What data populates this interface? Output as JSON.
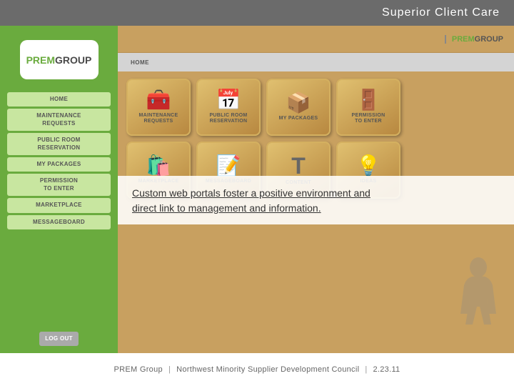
{
  "header": {
    "title": "Superior Client Care"
  },
  "sidebar": {
    "logo_prem": "PREM",
    "logo_group": "GROUP",
    "nav_items": [
      {
        "label": "HOME"
      },
      {
        "label": "MAINTENANCE REQUESTS"
      },
      {
        "label": "PUBLIC ROOM RESERVATION"
      },
      {
        "label": "MY PACKAGES"
      },
      {
        "label": "PERMISSION TO ENTER"
      },
      {
        "label": "MARKETPLACE"
      },
      {
        "label": "MESSAGEBOARD"
      }
    ]
  },
  "portal": {
    "logo_prem": "PREM",
    "logo_group": "GROUP",
    "nav_label": "HOME",
    "tiles": [
      {
        "icon": "🧰",
        "label": "MAINTENANCE\nREQUESTS"
      },
      {
        "icon": "📅",
        "label": "PUBLIC ROOM\nRESERVATION"
      },
      {
        "icon": "📦",
        "label": "MY PACKAGES"
      },
      {
        "icon": "🚪",
        "label": "PERMISSION\nTO ENTER"
      },
      {
        "icon": "🛍️",
        "label": "MARKETPLACE"
      },
      {
        "icon": "📝",
        "label": "MESSAGEBOARD"
      },
      {
        "icon": "T",
        "label": "CONTENT"
      },
      {
        "icon": "💡",
        "label": "IDEAS"
      }
    ]
  },
  "overlay": {
    "line1": "Custom web portals foster a positive environment and",
    "line2": "direct link to management and information."
  },
  "footer": {
    "brand": "PREM Group",
    "separator1": "|",
    "org": "Northwest Minority Supplier Development Council",
    "separator2": "|",
    "date": "2.23.11"
  }
}
